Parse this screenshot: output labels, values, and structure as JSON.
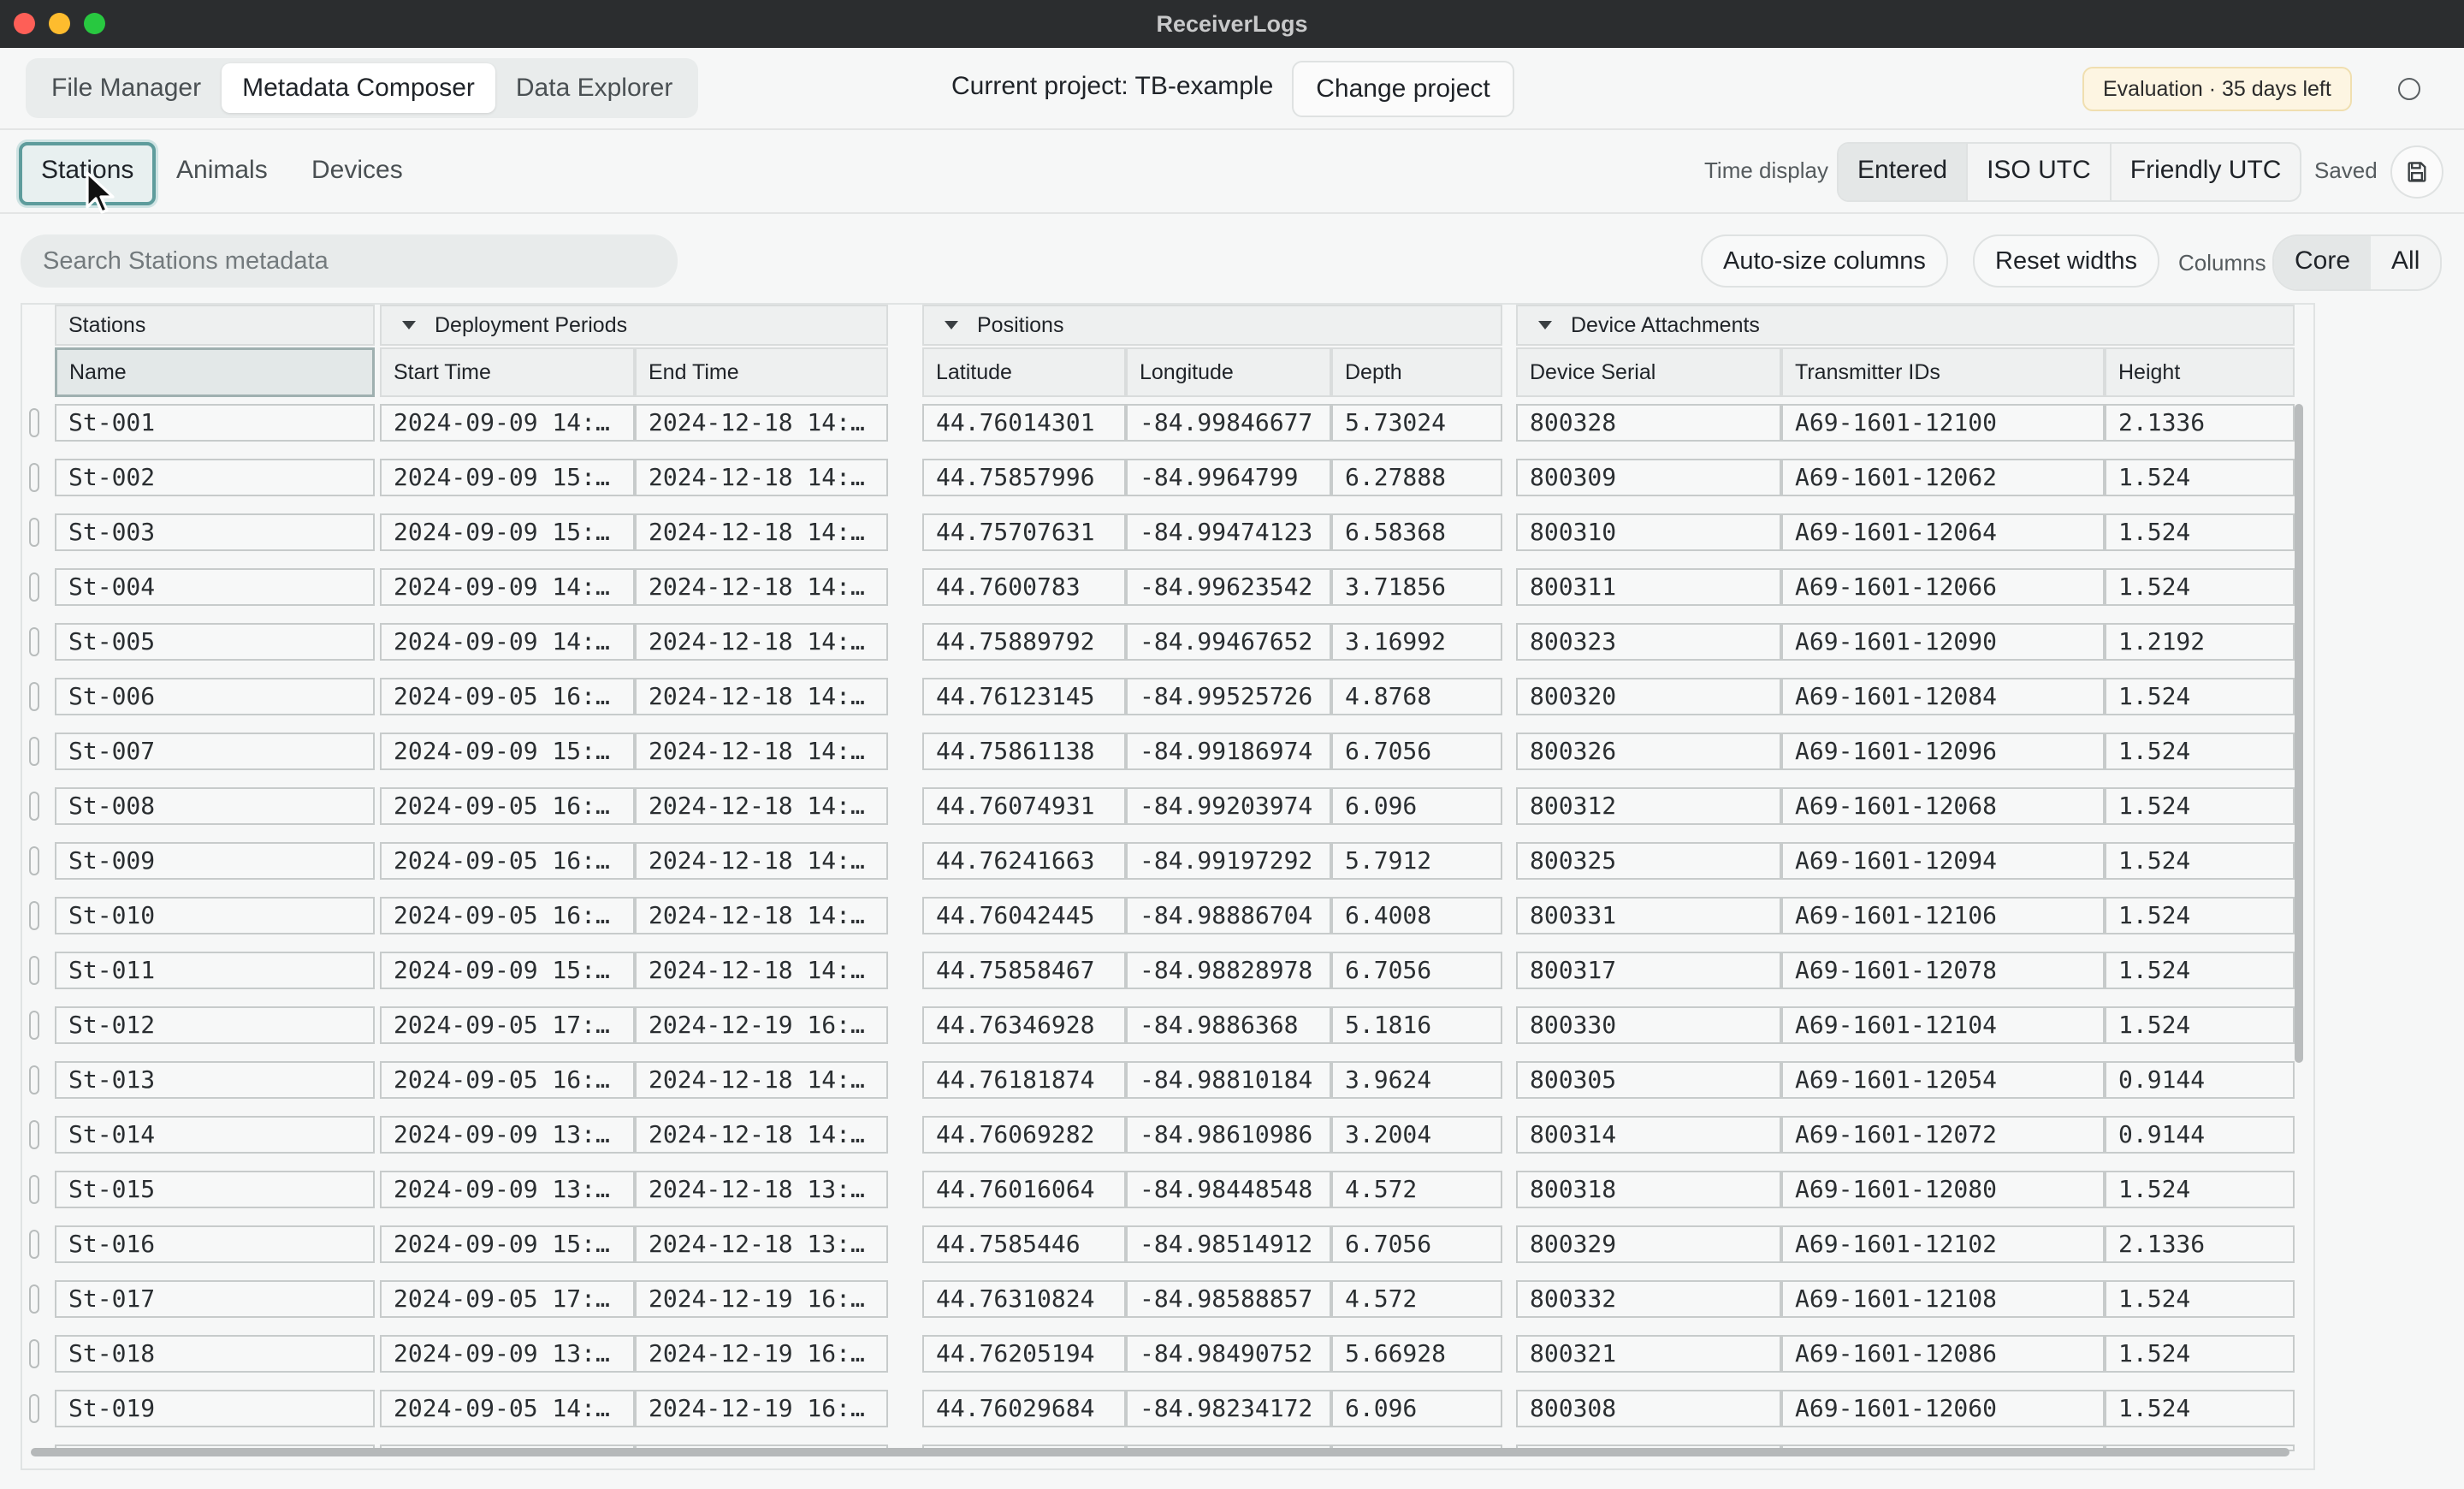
{
  "window": {
    "title": "ReceiverLogs"
  },
  "topbar": {
    "tabs": [
      {
        "label": "File Manager"
      },
      {
        "label": "Metadata Composer",
        "active": true
      },
      {
        "label": "Data Explorer"
      }
    ],
    "project_label": "Current project: TB-example",
    "change_project": "Change project",
    "evaluation_badge": "Evaluation · 35 days left"
  },
  "subbar": {
    "tabs": [
      {
        "label": "Stations",
        "active": true
      },
      {
        "label": "Animals"
      },
      {
        "label": "Devices"
      }
    ],
    "time_display_label": "Time display",
    "time_options": [
      "Entered",
      "ISO UTC",
      "Friendly UTC"
    ],
    "time_selected": "Entered",
    "saved_label": "Saved"
  },
  "toolbar": {
    "search_placeholder": "Search Stations metadata",
    "autosize_label": "Auto-size columns",
    "reset_label": "Reset widths",
    "columns_label": "Columns",
    "column_options": [
      "Core",
      "All"
    ],
    "column_selected": "Core"
  },
  "grid": {
    "groups": [
      "Stations",
      "Deployment Periods",
      "Positions",
      "Device Attachments"
    ],
    "columns": [
      "Name",
      "Start Time",
      "End Time",
      "Latitude",
      "Longitude",
      "Depth",
      "Device Serial",
      "Transmitter IDs",
      "Height"
    ],
    "rows": [
      [
        "St-001",
        "2024-09-09 14:…",
        "2024-12-18 14:…",
        "44.76014301",
        "-84.99846677",
        "5.73024",
        "800328",
        "A69-1601-12100",
        "2.1336"
      ],
      [
        "St-002",
        "2024-09-09 15:…",
        "2024-12-18 14:…",
        "44.75857996",
        "-84.9964799",
        "6.27888",
        "800309",
        "A69-1601-12062",
        "1.524"
      ],
      [
        "St-003",
        "2024-09-09 15:…",
        "2024-12-18 14:…",
        "44.75707631",
        "-84.99474123",
        "6.58368",
        "800310",
        "A69-1601-12064",
        "1.524"
      ],
      [
        "St-004",
        "2024-09-09 14:…",
        "2024-12-18 14:…",
        "44.7600783",
        "-84.99623542",
        "3.71856",
        "800311",
        "A69-1601-12066",
        "1.524"
      ],
      [
        "St-005",
        "2024-09-09 14:…",
        "2024-12-18 14:…",
        "44.75889792",
        "-84.99467652",
        "3.16992",
        "800323",
        "A69-1601-12090",
        "1.2192"
      ],
      [
        "St-006",
        "2024-09-05 16:…",
        "2024-12-18 14:…",
        "44.76123145",
        "-84.99525726",
        "4.8768",
        "800320",
        "A69-1601-12084",
        "1.524"
      ],
      [
        "St-007",
        "2024-09-09 15:…",
        "2024-12-18 14:…",
        "44.75861138",
        "-84.99186974",
        "6.7056",
        "800326",
        "A69-1601-12096",
        "1.524"
      ],
      [
        "St-008",
        "2024-09-05 16:…",
        "2024-12-18 14:…",
        "44.76074931",
        "-84.99203974",
        "6.096",
        "800312",
        "A69-1601-12068",
        "1.524"
      ],
      [
        "St-009",
        "2024-09-05 16:…",
        "2024-12-18 14:…",
        "44.76241663",
        "-84.99197292",
        "5.7912",
        "800325",
        "A69-1601-12094",
        "1.524"
      ],
      [
        "St-010",
        "2024-09-05 16:…",
        "2024-12-18 14:…",
        "44.76042445",
        "-84.98886704",
        "6.4008",
        "800331",
        "A69-1601-12106",
        "1.524"
      ],
      [
        "St-011",
        "2024-09-09 15:…",
        "2024-12-18 14:…",
        "44.75858467",
        "-84.98828978",
        "6.7056",
        "800317",
        "A69-1601-12078",
        "1.524"
      ],
      [
        "St-012",
        "2024-09-05 17:…",
        "2024-12-19 16:…",
        "44.76346928",
        "-84.9886368",
        "5.1816",
        "800330",
        "A69-1601-12104",
        "1.524"
      ],
      [
        "St-013",
        "2024-09-05 16:…",
        "2024-12-18 14:…",
        "44.76181874",
        "-84.98810184",
        "3.9624",
        "800305",
        "A69-1601-12054",
        "0.9144"
      ],
      [
        "St-014",
        "2024-09-09 13:…",
        "2024-12-18 14:…",
        "44.76069282",
        "-84.98610986",
        "3.2004",
        "800314",
        "A69-1601-12072",
        "0.9144"
      ],
      [
        "St-015",
        "2024-09-09 13:…",
        "2024-12-18 13:…",
        "44.76016064",
        "-84.98448548",
        "4.572",
        "800318",
        "A69-1601-12080",
        "1.524"
      ],
      [
        "St-016",
        "2024-09-09 15:…",
        "2024-12-18 13:…",
        "44.7585446",
        "-84.98514912",
        "6.7056",
        "800329",
        "A69-1601-12102",
        "2.1336"
      ],
      [
        "St-017",
        "2024-09-05 17:…",
        "2024-12-19 16:…",
        "44.76310824",
        "-84.98588857",
        "4.572",
        "800332",
        "A69-1601-12108",
        "1.524"
      ],
      [
        "St-018",
        "2024-09-09 13:…",
        "2024-12-19 16:…",
        "44.76205194",
        "-84.98490752",
        "5.66928",
        "800321",
        "A69-1601-12086",
        "1.524"
      ],
      [
        "St-019",
        "2024-09-05 14:…",
        "2024-12-19 16:…",
        "44.76029684",
        "-84.98234172",
        "6.096",
        "800308",
        "A69-1601-12060",
        "1.524"
      ]
    ]
  }
}
